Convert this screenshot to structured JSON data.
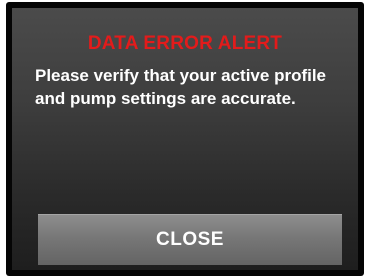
{
  "alert": {
    "title": "DATA ERROR ALERT",
    "message": "Please verify that your active profile and pump settings are accurate.",
    "close_label": "CLOSE"
  },
  "colors": {
    "title": "#e31b1b",
    "text": "#ffffff",
    "button": "#777777",
    "screen": "#3e3e3e"
  }
}
